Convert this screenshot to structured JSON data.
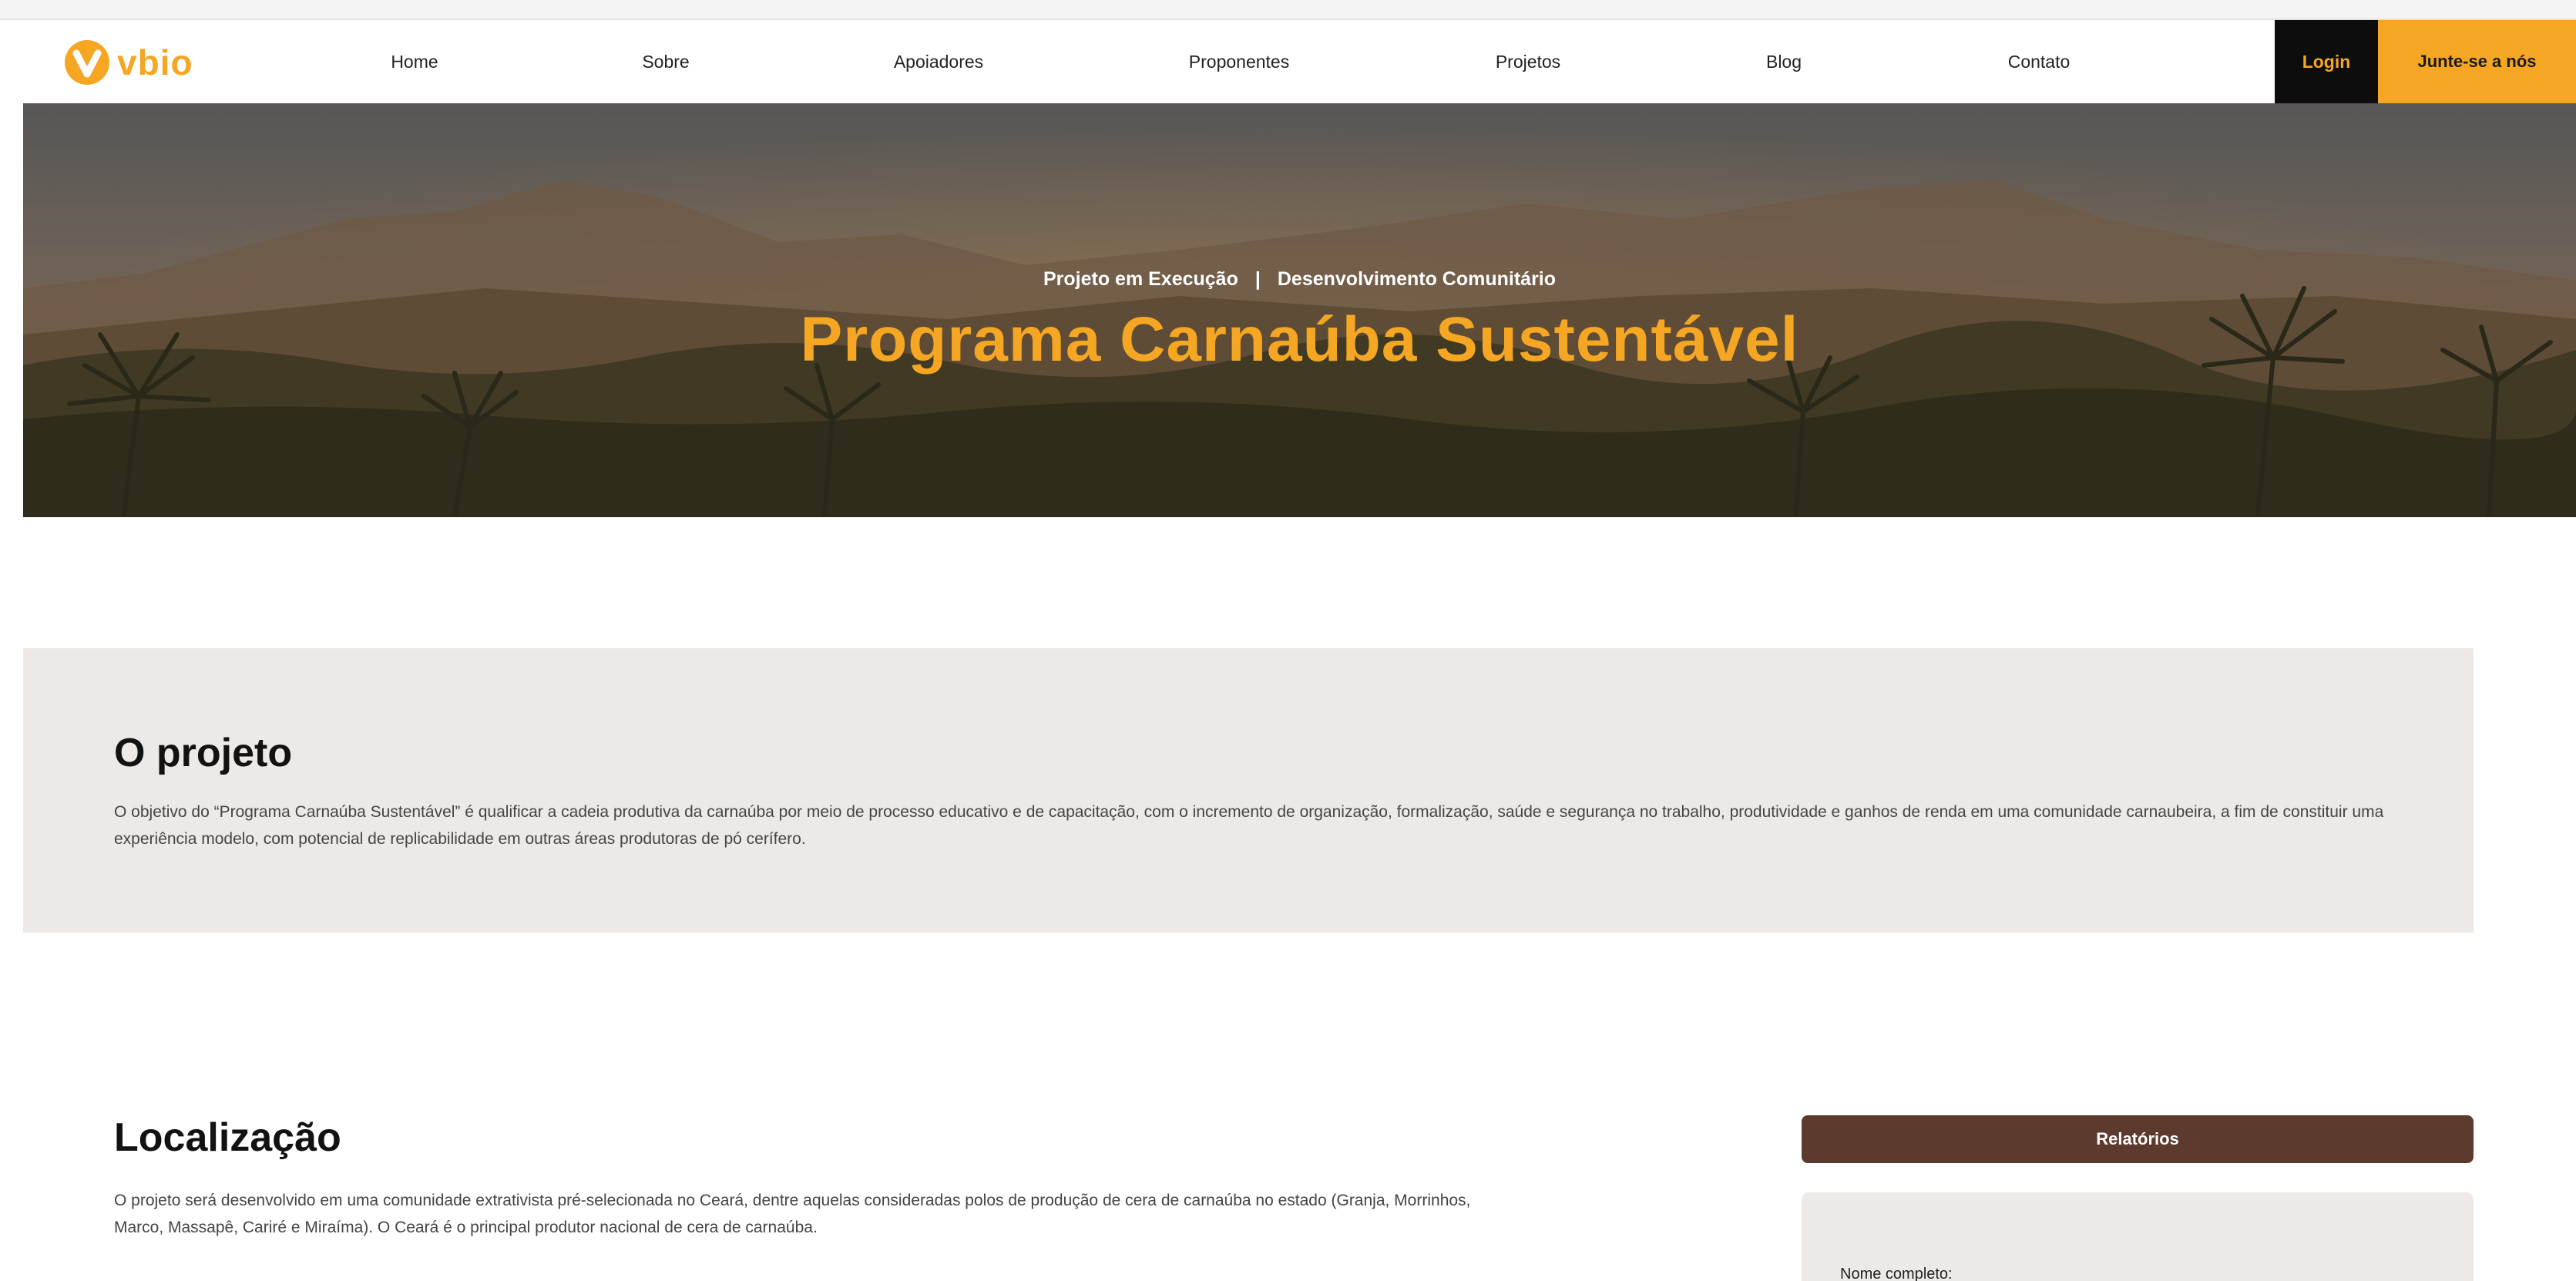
{
  "brand": {
    "name": "vbio",
    "accent": "#f5a623",
    "dark": "#0d0d0d",
    "brown": "#5c3a2e"
  },
  "nav": {
    "items": [
      {
        "label": "Home"
      },
      {
        "label": "Sobre"
      },
      {
        "label": "Apoiadores"
      },
      {
        "label": "Proponentes"
      },
      {
        "label": "Projetos"
      },
      {
        "label": "Blog"
      },
      {
        "label": "Contato"
      }
    ],
    "login_label": "Login",
    "join_label": "Junte-se a nós"
  },
  "hero": {
    "status": "Projeto em Execução",
    "separator": "|",
    "category": "Desenvolvimento Comunitário",
    "title": "Programa Carnaúba Sustentável"
  },
  "project": {
    "heading": "O projeto",
    "text": "O objetivo do “Programa Carnaúba Sustentável” é qualificar a cadeia produtiva da carnaúba por meio de processo educativo e de capacitação, com o incremento de organização, formalização, saúde e segurança no trabalho, produtividade e ganhos de renda em uma comunidade carnaubeira, a fim de constituir uma experiência modelo, com potencial de replicabilidade em outras áreas produtoras de pó cerífero."
  },
  "location": {
    "heading": "Localização",
    "text": "O projeto será desenvolvido em uma comunidade extrativista pré-selecionada no Ceará, dentre aquelas consideradas polos de produção de cera de carnaúba no estado (Granja, Morrinhos, Marco, Massapê, Cariré e Miraíma). O Ceará é o principal produtor nacional de cera de carnaúba."
  },
  "sidebar": {
    "reports_label": "Relatórios",
    "form_label": "Nome completo:"
  }
}
